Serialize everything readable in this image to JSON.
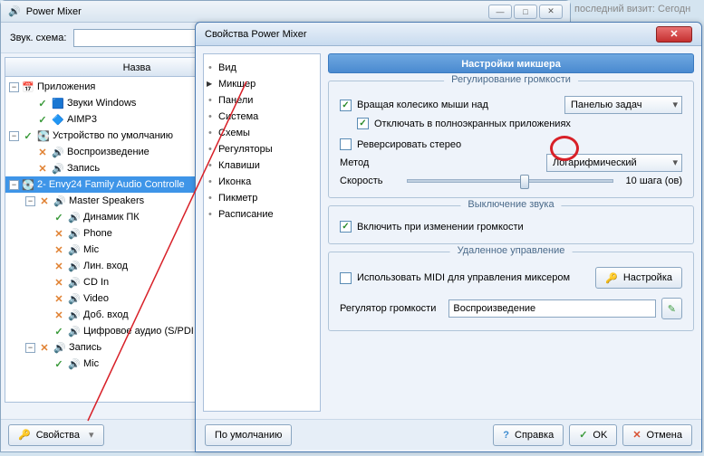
{
  "main_window": {
    "title": "Power Mixer",
    "extra_text": "последний визит: Сегодн",
    "scheme_label": "Звук. схема:",
    "tree_header": "Назва",
    "apps_label": "Приложения",
    "app_items": [
      "Звуки Windows",
      "AIMP3"
    ],
    "default_device_label": "Устройство по умолчанию",
    "default_items": [
      "Воспроизведение",
      "Запись"
    ],
    "device_label": "2- Envy24 Family Audio Controlle",
    "master_label": "Master Speakers",
    "channels": [
      "Динамик ПК",
      "Phone",
      "Mic",
      "Лин. вход",
      "CD In",
      "Video",
      "Доб. вход",
      "Цифровое аудио (S/PDI",
      "Запись",
      "Mic"
    ],
    "props_btn": "Свойства"
  },
  "dialog": {
    "title": "Свойства Power Mixer",
    "nav": [
      "Вид",
      "Микшер",
      "Панели",
      "Система",
      "Схемы",
      "Регуляторы",
      "Клавиши",
      "Иконка",
      "Пикметр",
      "Расписание"
    ],
    "section_title": "Настройки микшера",
    "group_volume": "Регулирование громкости",
    "wheel_label": "Вращая колесико мыши над",
    "wheel_target": "Панелью задач",
    "fullscreen_label": "Отключать в полноэкранных приложениях",
    "reverse_label": "Реверсировать стерео",
    "method_label": "Метод",
    "method_value": "Логарифмический",
    "speed_label": "Скорость",
    "speed_value": "10 шага (ов)",
    "group_mute": "Выключение звука",
    "mute_toggle_label": "Включить при изменении громкости",
    "group_remote": "Удаленное управление",
    "midi_label": "Использовать MIDI для управления миксером",
    "configure_btn": "Настройка",
    "volctrl_label": "Регулятор громкости",
    "volctrl_value": "Воспроизведение",
    "defaults_btn": "По умолчанию",
    "help_btn": "Справка",
    "ok_btn": "OK",
    "cancel_btn": "Отмена"
  }
}
